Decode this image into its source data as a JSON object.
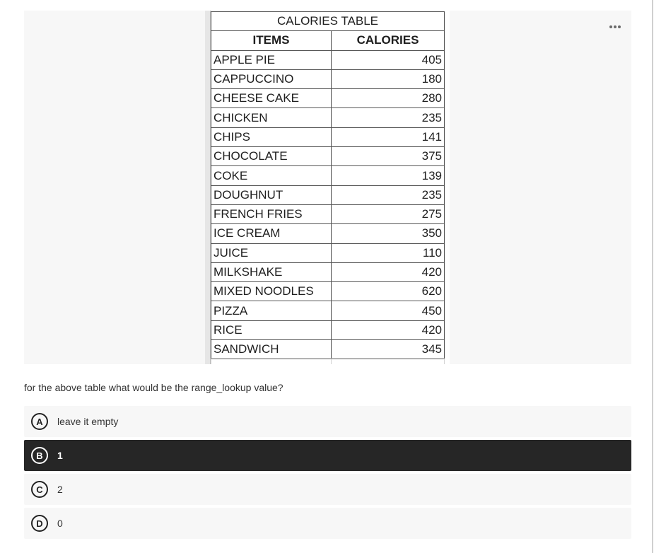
{
  "image": {
    "table_title": "CALORIES TABLE",
    "headers": [
      "ITEMS",
      "CALORIES"
    ],
    "rows": [
      {
        "item": "APPLE PIE",
        "calories": "405"
      },
      {
        "item": "CAPPUCCINO",
        "calories": "180"
      },
      {
        "item": "CHEESE CAKE",
        "calories": "280"
      },
      {
        "item": "CHICKEN",
        "calories": "235"
      },
      {
        "item": "CHIPS",
        "calories": "141"
      },
      {
        "item": "CHOCOLATE",
        "calories": "375"
      },
      {
        "item": "COKE",
        "calories": "139"
      },
      {
        "item": "DOUGHNUT",
        "calories": "235"
      },
      {
        "item": "FRENCH FRIES",
        "calories": "275"
      },
      {
        "item": "ICE CREAM",
        "calories": "350"
      },
      {
        "item": "JUICE",
        "calories": "110"
      },
      {
        "item": "MILKSHAKE",
        "calories": "420"
      },
      {
        "item": "MIXED NOODLES",
        "calories": "620"
      },
      {
        "item": "PIZZA",
        "calories": "450"
      },
      {
        "item": "RICE",
        "calories": "420"
      },
      {
        "item": "SANDWICH",
        "calories": "345"
      }
    ],
    "more_icon": "more-horizontal-icon"
  },
  "question": {
    "text": "for the above table what would be the range_lookup value?",
    "options": [
      {
        "letter": "A",
        "label": "leave it empty",
        "selected": false
      },
      {
        "letter": "B",
        "label": "1",
        "selected": true
      },
      {
        "letter": "C",
        "label": "2",
        "selected": false
      },
      {
        "letter": "D",
        "label": "0",
        "selected": false
      }
    ]
  },
  "colors": {
    "selected_bg": "#262626",
    "option_bg": "#f7f7f7",
    "panel_bg": "#f7f7f7"
  }
}
